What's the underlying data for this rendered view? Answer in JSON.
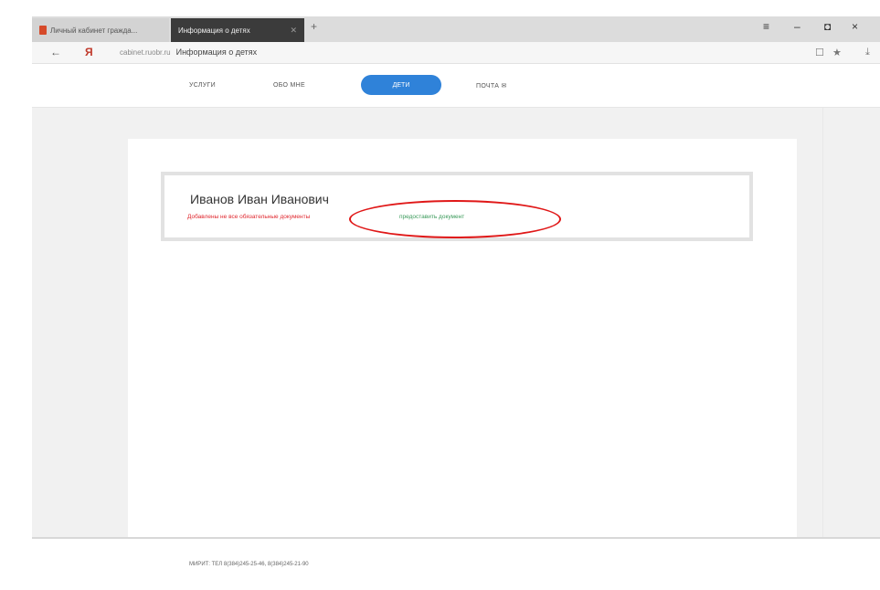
{
  "browser": {
    "tabs": [
      {
        "label": "Личный кабинет гражда...",
        "active": false
      },
      {
        "label": "Информация о детях",
        "active": true
      }
    ],
    "new_tab": "+",
    "window_controls": {
      "menu": "≡",
      "minimize": "–",
      "maximize": "◘",
      "close": "×"
    },
    "address": {
      "domain": "cabinet.ruobr.ru",
      "page_title": "Информация о детях"
    },
    "icons": {
      "back": "←",
      "reload": "↻",
      "reader": "☐",
      "bookmark": "★",
      "download": "⤓"
    }
  },
  "site_nav": {
    "items": [
      {
        "label": "УСЛУГИ",
        "active": false
      },
      {
        "label": "ОБО МНЕ",
        "active": false
      },
      {
        "label": "ДЕТИ",
        "active": true
      },
      {
        "label": "ПОЧТА",
        "active": false
      }
    ],
    "mail_icon": "✉"
  },
  "child_card": {
    "name": "Иванов Иван Иванович",
    "warning": "Добавлены не все обязательные документы",
    "action": "предоставить документ"
  },
  "footer": {
    "text": "МИРИТ: ТЕЛ 8(384)245-25-46, 8(384)245-21-90"
  },
  "colors": {
    "accent": "#2f82d9",
    "warning": "#e0282f",
    "link": "#3a9a5a",
    "annotation": "#e01818"
  }
}
